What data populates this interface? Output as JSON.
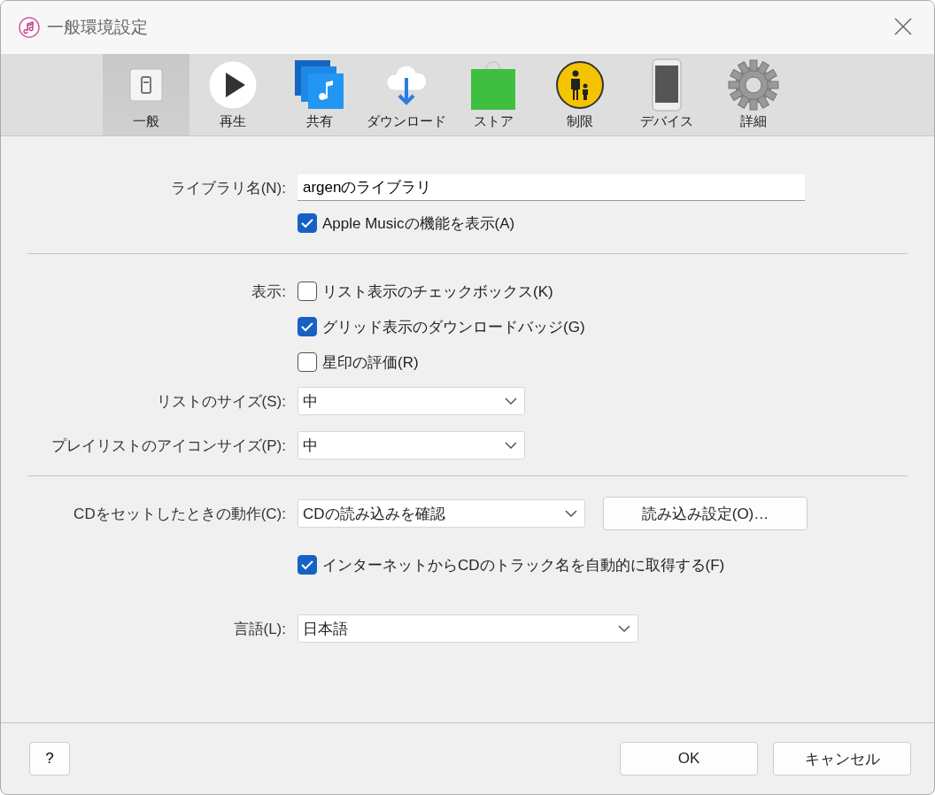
{
  "window": {
    "title": "一般環境設定"
  },
  "toolbar": [
    {
      "label": "一般",
      "kind": "general",
      "selected": true
    },
    {
      "label": "再生",
      "kind": "playback",
      "selected": false
    },
    {
      "label": "共有",
      "kind": "sharing",
      "selected": false
    },
    {
      "label": "ダウンロード",
      "kind": "download",
      "selected": false
    },
    {
      "label": "ストア",
      "kind": "store",
      "selected": false
    },
    {
      "label": "制限",
      "kind": "restrictions",
      "selected": false
    },
    {
      "label": "デバイス",
      "kind": "devices",
      "selected": false
    },
    {
      "label": "詳細",
      "kind": "advanced",
      "selected": false
    }
  ],
  "sections": [
    [
      {
        "kind": "text",
        "label": "ライブラリ名(N):",
        "value": "argenのライブラリ"
      },
      {
        "kind": "checkbox",
        "text": "Apple Musicの機能を表示(A)",
        "checked": true
      }
    ],
    [
      {
        "kind": "checkbox",
        "label": "表示:",
        "text": "リスト表示のチェックボックス(K)",
        "checked": false
      },
      {
        "kind": "checkbox",
        "text": "グリッド表示のダウンロードバッジ(G)",
        "checked": true
      },
      {
        "kind": "checkbox",
        "text": "星印の評価(R)",
        "checked": false
      },
      {
        "kind": "dropdown",
        "label": "リストのサイズ(S):",
        "value": "中"
      },
      {
        "kind": "dropdown",
        "label": "プレイリストのアイコンサイズ(P):",
        "value": "中"
      }
    ],
    [
      {
        "kind": "dropdown",
        "label": "CDをセットしたときの動作(C):",
        "value": "CDの読み込みを確認",
        "button": "読み込み設定(O)…"
      },
      {
        "kind": "checkbox",
        "text": "インターネットからCDのトラック名を自動的に取得する(F)",
        "checked": true
      },
      {
        "kind": "dropdown",
        "label": "言語(L):",
        "value": "日本語"
      }
    ]
  ],
  "help_button": "?",
  "buttons": [
    "OK",
    "キャンセル"
  ]
}
